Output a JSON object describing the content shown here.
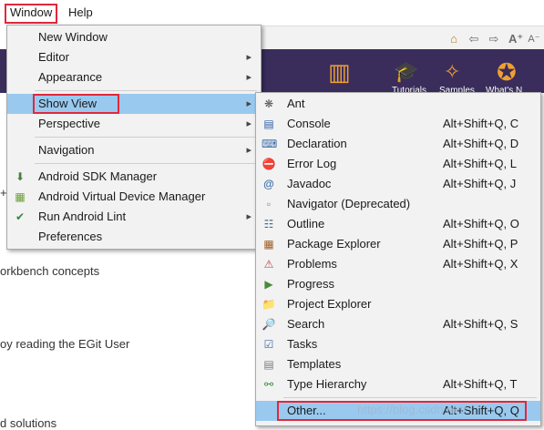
{
  "menubar": {
    "window_label": "Window",
    "help_label": "Help"
  },
  "banner": {
    "labels": [
      "Tutorials",
      "Samples",
      "What's N"
    ]
  },
  "background_text": {
    "line1": "orkbench concepts",
    "line2": "oy reading the EGit User",
    "line3": "d solutions",
    "plus": "+"
  },
  "window_menu": {
    "items": [
      {
        "label": "New Window"
      },
      {
        "label": "Editor"
      },
      {
        "label": "Appearance"
      },
      {
        "label": "Show View"
      },
      {
        "label": "Perspective"
      },
      {
        "label": "Navigation"
      },
      {
        "label": "Android SDK Manager"
      },
      {
        "label": "Android Virtual Device Manager"
      },
      {
        "label": "Run Android Lint"
      },
      {
        "label": "Preferences"
      }
    ]
  },
  "show_view_menu": {
    "items": [
      {
        "label": "Ant",
        "shortcut": "",
        "icon": "ant-icon"
      },
      {
        "label": "Console",
        "shortcut": "Alt+Shift+Q, C",
        "icon": "console-icon"
      },
      {
        "label": "Declaration",
        "shortcut": "Alt+Shift+Q, D",
        "icon": "declaration-icon"
      },
      {
        "label": "Error Log",
        "shortcut": "Alt+Shift+Q, L",
        "icon": "error-log-icon"
      },
      {
        "label": "Javadoc",
        "shortcut": "Alt+Shift+Q, J",
        "icon": "javadoc-icon"
      },
      {
        "label": "Navigator (Deprecated)",
        "shortcut": "",
        "icon": "navigator-icon"
      },
      {
        "label": "Outline",
        "shortcut": "Alt+Shift+Q, O",
        "icon": "outline-icon"
      },
      {
        "label": "Package Explorer",
        "shortcut": "Alt+Shift+Q, P",
        "icon": "package-explorer-icon"
      },
      {
        "label": "Problems",
        "shortcut": "Alt+Shift+Q, X",
        "icon": "problems-icon"
      },
      {
        "label": "Progress",
        "shortcut": "",
        "icon": "progress-icon"
      },
      {
        "label": "Project Explorer",
        "shortcut": "",
        "icon": "project-explorer-icon"
      },
      {
        "label": "Search",
        "shortcut": "Alt+Shift+Q, S",
        "icon": "search-icon"
      },
      {
        "label": "Tasks",
        "shortcut": "",
        "icon": "tasks-icon"
      },
      {
        "label": "Templates",
        "shortcut": "",
        "icon": "templates-icon"
      },
      {
        "label": "Type Hierarchy",
        "shortcut": "Alt+Shift+Q, T",
        "icon": "type-hierarchy-icon"
      },
      {
        "label": "Other...",
        "shortcut": "Alt+Shift+Q, Q",
        "icon": ""
      }
    ]
  },
  "watermark": "https://blog.csdn.net/..."
}
